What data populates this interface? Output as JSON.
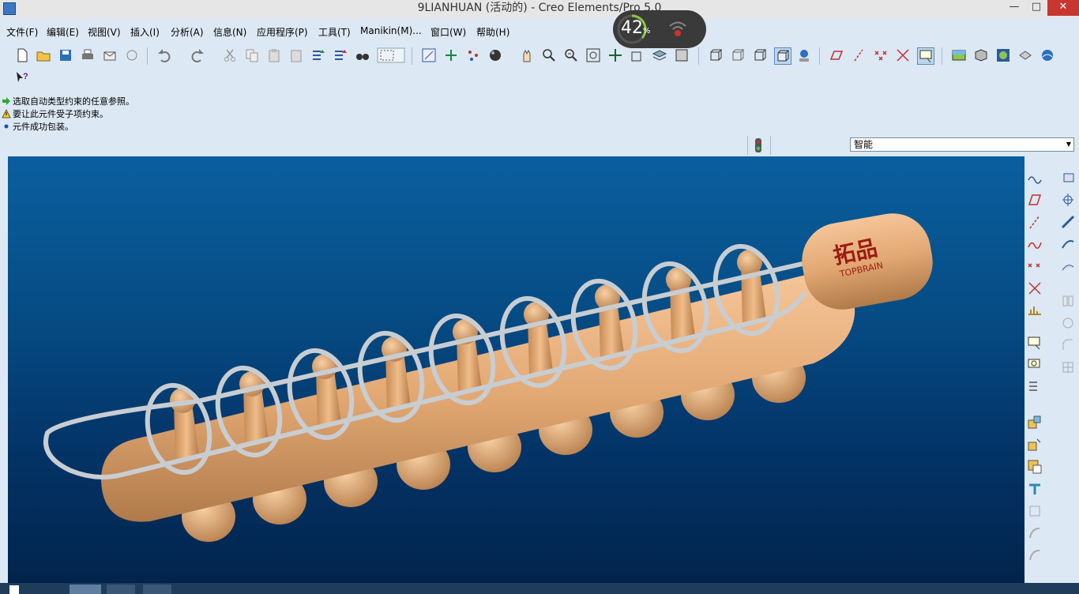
{
  "window": {
    "title": "9LIANHUAN (活动的) - Creo Elements/Pro 5.0",
    "minimize_label": "—",
    "maximize_label": "□",
    "close_label": "✕"
  },
  "menu": [
    {
      "label": "文件(F)"
    },
    {
      "label": "编辑(E)"
    },
    {
      "label": "视图(V)"
    },
    {
      "label": "插入(I)"
    },
    {
      "label": "分析(A)"
    },
    {
      "label": "信息(N)"
    },
    {
      "label": "应用程序(P)"
    },
    {
      "label": "工具(T)"
    },
    {
      "label": "Manikin(M)..."
    },
    {
      "label": "窗口(W)"
    },
    {
      "label": "帮助(H)"
    }
  ],
  "messages": [
    {
      "icon": "green-arrow-icon",
      "text": "选取自动类型约束的任意参照。"
    },
    {
      "icon": "warning-icon",
      "text": "要让此元件受子项约束。"
    },
    {
      "icon": "info-bullet-icon",
      "text": "元件成功包装。"
    }
  ],
  "filter": {
    "selected": "智能"
  },
  "model": {
    "label_cn": "拓品",
    "label_en": "TOPBRAIN"
  },
  "overlay": {
    "percent": "42",
    "unit": "%"
  },
  "colors": {
    "accent": "#0a5f9e",
    "panel": "#dce8f3",
    "model_body": "#e8b07f",
    "wire": "#c8cdd2",
    "logo": "#9a1c14"
  }
}
